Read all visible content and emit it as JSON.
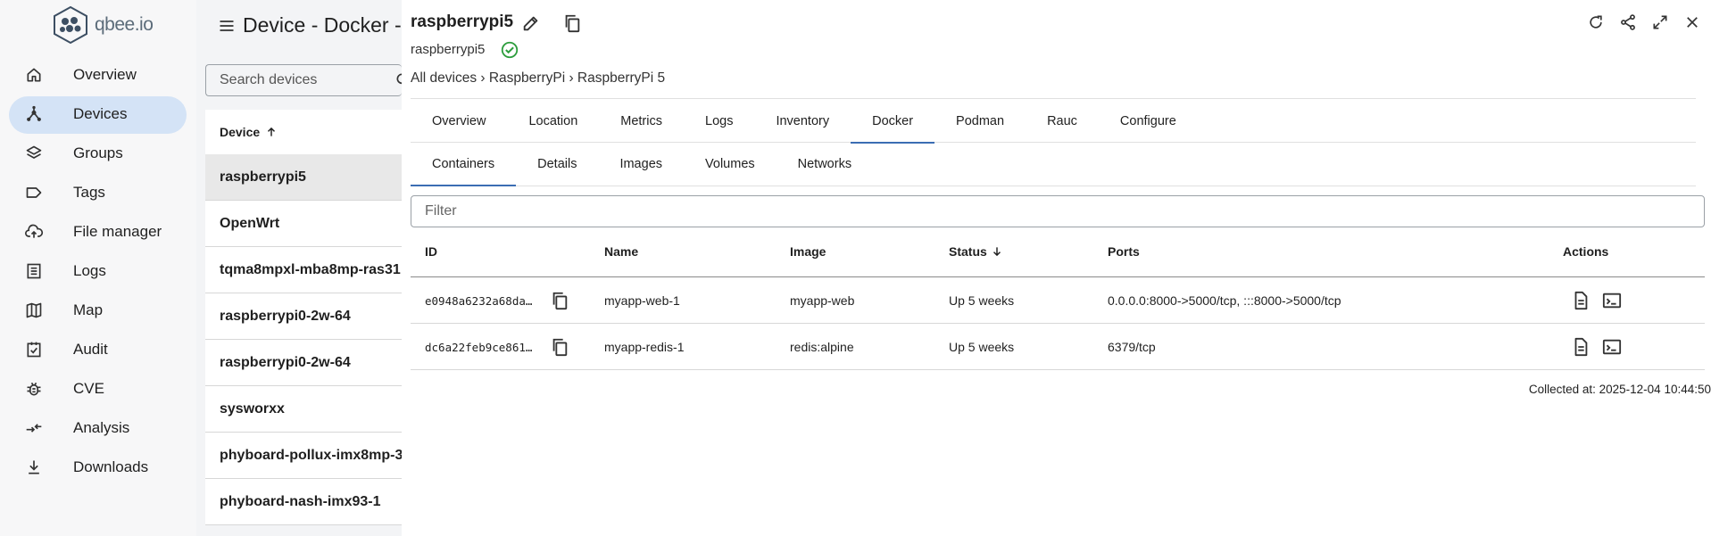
{
  "brand": {
    "name": "qbee.io"
  },
  "nav": {
    "items": [
      {
        "label": "Overview",
        "icon": "home-icon"
      },
      {
        "label": "Devices",
        "icon": "devices-icon",
        "active": true
      },
      {
        "label": "Groups",
        "icon": "layers-icon"
      },
      {
        "label": "Tags",
        "icon": "tag-icon"
      },
      {
        "label": "File manager",
        "icon": "cloud-upload-icon"
      },
      {
        "label": "Logs",
        "icon": "list-icon"
      },
      {
        "label": "Map",
        "icon": "map-icon"
      },
      {
        "label": "Audit",
        "icon": "audit-icon"
      },
      {
        "label": "CVE",
        "icon": "bug-icon"
      },
      {
        "label": "Analysis",
        "icon": "compare-icon"
      },
      {
        "label": "Downloads",
        "icon": "download-icon"
      }
    ]
  },
  "device_list": {
    "title": "Device - Docker - C",
    "search_placeholder": "Search devices",
    "column_header": "Device",
    "rows": [
      {
        "name": "raspberrypi5",
        "selected": true
      },
      {
        "name": "OpenWrt"
      },
      {
        "name": "tqma8mpxl-mba8mp-ras31"
      },
      {
        "name": "raspberrypi0-2w-64"
      },
      {
        "name": "raspberrypi0-2w-64"
      },
      {
        "name": "sysworxx"
      },
      {
        "name": "phyboard-pollux-imx8mp-3"
      },
      {
        "name": "phyboard-nash-imx93-1"
      }
    ]
  },
  "detail": {
    "title": "raspberrypi5",
    "subtitle": "raspberrypi5",
    "breadcrumb": "All devices › RaspberryPi › RaspberryPi 5",
    "tabs": [
      "Overview",
      "Location",
      "Metrics",
      "Logs",
      "Inventory",
      "Docker",
      "Podman",
      "Rauc",
      "Configure"
    ],
    "active_tab": "Docker",
    "subtabs": [
      "Containers",
      "Details",
      "Images",
      "Volumes",
      "Networks"
    ],
    "active_subtab": "Containers",
    "filter_placeholder": "Filter",
    "table": {
      "columns": {
        "id": "ID",
        "name": "Name",
        "image": "Image",
        "status": "Status",
        "ports": "Ports",
        "actions": "Actions"
      },
      "rows": [
        {
          "id": "e0948a6232a68da…",
          "name": "myapp-web-1",
          "image": "myapp-web",
          "status": "Up 5 weeks",
          "ports": "0.0.0.0:8000->5000/tcp, :::8000->5000/tcp"
        },
        {
          "id": "dc6a22feb9ce861…",
          "name": "myapp-redis-1",
          "image": "redis:alpine",
          "status": "Up 5 weeks",
          "ports": "6379/tcp"
        }
      ]
    },
    "collected_at": "Collected at: 2025-12-04 10:44:50"
  },
  "colors": {
    "accent": "#3b6db3",
    "nav_active": "#d4e3f6",
    "status_ok": "#2e9e3e"
  }
}
